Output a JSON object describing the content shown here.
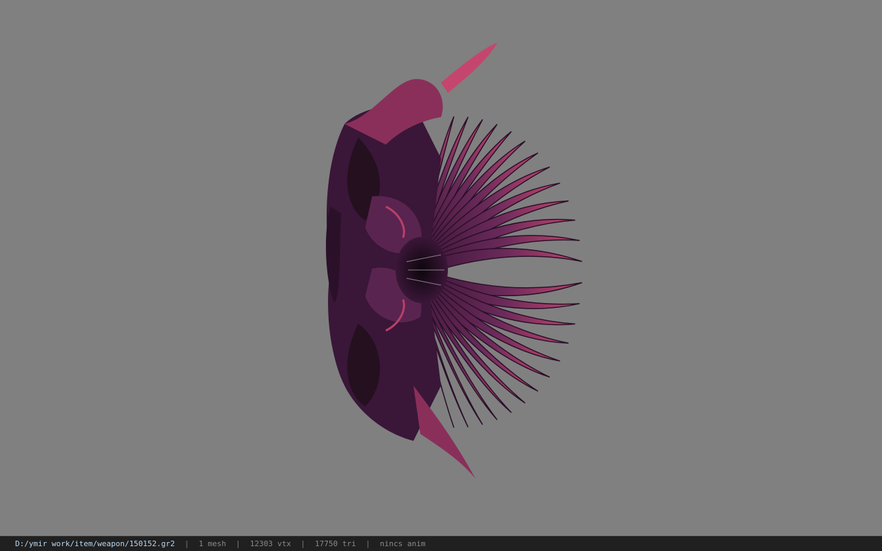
{
  "viewport": {
    "background_color": "#808080",
    "model": {
      "description_icon": "weapon-model",
      "primary_color": "#b8406a",
      "shadow_color": "#2a1028",
      "mid_color": "#5a2450"
    }
  },
  "status_bar": {
    "file_path": "D:/ymir work/item/weapon/150152.gr2",
    "sep": "|",
    "mesh_count": "1 mesh",
    "vertex_count": "12303 vtx",
    "triangle_count": "17750 tri",
    "anim_status": "nincs anim"
  }
}
